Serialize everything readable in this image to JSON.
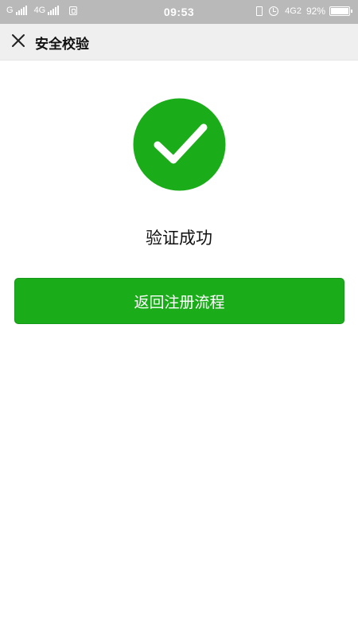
{
  "status_bar": {
    "sim1_label": "G",
    "sim2_label": "4G",
    "time": "09:53",
    "network": "4G2",
    "battery": "92%"
  },
  "header": {
    "title": "安全校验",
    "close_icon": "close-icon"
  },
  "main": {
    "success_icon": "check-circle-icon",
    "success_color": "#1aad19",
    "result_text": "验证成功",
    "return_button_label": "返回注册流程"
  }
}
